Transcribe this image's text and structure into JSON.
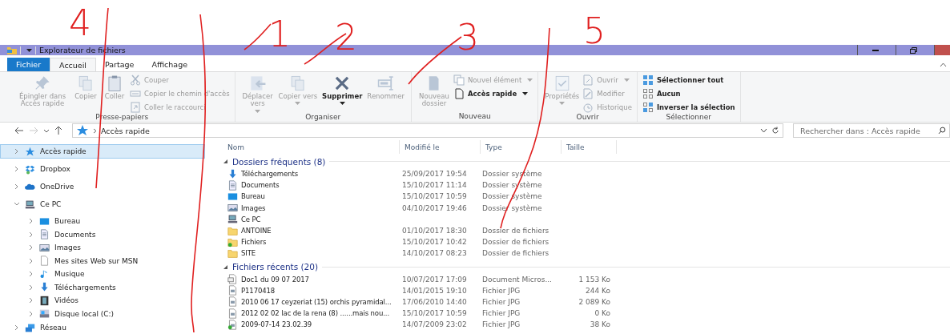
{
  "annotations": [
    "4",
    "1",
    "2",
    "3",
    "5"
  ],
  "window": {
    "title": "Explorateur de fichiers"
  },
  "tabs": [
    {
      "label": "Fichier",
      "kind": "file",
      "selected": false
    },
    {
      "label": "Accueil",
      "kind": "tab",
      "selected": true
    },
    {
      "label": "Partage",
      "kind": "tab",
      "selected": false
    },
    {
      "label": "Affichage",
      "kind": "tab",
      "selected": false
    }
  ],
  "ribbon": {
    "groups": [
      {
        "label": "Presse-papiers",
        "large": [
          {
            "label": "Épingler dans Accès rapide",
            "kind": "pin",
            "disabled": true,
            "dropdown": false
          },
          {
            "label": "Copier",
            "kind": "copy",
            "disabled": true,
            "dropdown": false
          },
          {
            "label": "Coller",
            "kind": "paste",
            "disabled": true,
            "dropdown": false
          }
        ],
        "small": [
          {
            "label": "Couper",
            "kind": "cut",
            "disabled": true,
            "dropdown": false
          },
          {
            "label": "Copier le chemin d'accès",
            "kind": "path",
            "disabled": true,
            "dropdown": false
          },
          {
            "label": "Coller le raccourci",
            "kind": "shortcut",
            "disabled": true,
            "dropdown": false
          }
        ]
      },
      {
        "label": "Organiser",
        "large": [
          {
            "label": "Déplacer vers",
            "kind": "move",
            "disabled": true,
            "dropdown": true
          },
          {
            "label": "Copier vers",
            "kind": "copyto",
            "disabled": true,
            "dropdown": true
          },
          {
            "label": "Supprimer",
            "kind": "delete",
            "disabled": false,
            "dropdown": true
          },
          {
            "label": "Renommer",
            "kind": "rename",
            "disabled": true,
            "dropdown": false
          }
        ]
      },
      {
        "label": "Nouveau",
        "large": [
          {
            "label": "Nouveau dossier",
            "kind": "newfolder",
            "disabled": true,
            "dropdown": false
          }
        ],
        "small": [
          {
            "label": "Nouvel élément",
            "kind": "newitem",
            "disabled": true,
            "dropdown": true
          },
          {
            "label": "Accès rapide",
            "kind": "easy",
            "disabled": false,
            "dropdown": true
          }
        ]
      },
      {
        "label": "Ouvrir",
        "large": [
          {
            "label": "Propriétés",
            "kind": "props",
            "disabled": true,
            "dropdown": true
          }
        ],
        "small": [
          {
            "label": "Ouvrir",
            "kind": "open",
            "disabled": true,
            "dropdown": true
          },
          {
            "label": "Modifier",
            "kind": "edit",
            "disabled": true,
            "dropdown": false
          },
          {
            "label": "Historique",
            "kind": "history",
            "disabled": true,
            "dropdown": false
          }
        ]
      },
      {
        "label": "Sélectionner",
        "small": [
          {
            "label": "Sélectionner tout",
            "kind": "selall",
            "disabled": false,
            "dropdown": false
          },
          {
            "label": "Aucun",
            "kind": "selnone",
            "disabled": false,
            "dropdown": false
          },
          {
            "label": "Inverser la sélection",
            "kind": "selinv",
            "disabled": false,
            "dropdown": false
          }
        ]
      }
    ]
  },
  "address": {
    "location": "Accès rapide",
    "forward_disabled": true
  },
  "search": {
    "placeholder": "Rechercher dans : Accès rapide"
  },
  "sidebar": {
    "items": [
      {
        "label": "Accès rapide",
        "kind": "star",
        "selected": true,
        "expanded": false
      },
      {
        "label": "Dropbox",
        "kind": "dropbox",
        "selected": false,
        "expanded": false
      },
      {
        "label": "OneDrive",
        "kind": "cloud",
        "selected": false,
        "expanded": false
      },
      {
        "label": "Ce PC",
        "kind": "pc",
        "selected": false,
        "expanded": true,
        "children": [
          {
            "label": "Bureau",
            "kind": "desktop",
            "selected": false,
            "expanded": false
          },
          {
            "label": "Documents",
            "kind": "docs",
            "selected": false,
            "expanded": false
          },
          {
            "label": "Images",
            "kind": "pictures",
            "selected": false,
            "expanded": false
          },
          {
            "label": "Mes sites Web sur MSN",
            "kind": "file",
            "selected": false,
            "expanded": false
          },
          {
            "label": "Musique",
            "kind": "music",
            "selected": false,
            "expanded": false
          },
          {
            "label": "Téléchargements",
            "kind": "download",
            "selected": false,
            "expanded": false
          },
          {
            "label": "Vidéos",
            "kind": "video",
            "selected": false,
            "expanded": false
          },
          {
            "label": "Disque local (C:)",
            "kind": "drive",
            "selected": false,
            "expanded": false
          }
        ]
      },
      {
        "label": "Réseau",
        "kind": "network",
        "selected": false,
        "expanded": false
      }
    ]
  },
  "table": {
    "columns": [
      "Nom",
      "Modifié le",
      "Type",
      "Taille"
    ],
    "groups": [
      {
        "title": "Dossiers fréquents (8)",
        "expanded": true,
        "rows": [
          {
            "name": "Téléchargements",
            "kind": "download",
            "modified": "25/09/2017 19:54",
            "type": "Dossier système"
          },
          {
            "name": "Documents",
            "kind": "docs",
            "modified": "15/10/2017 11:14",
            "type": "Dossier système"
          },
          {
            "name": "Bureau",
            "kind": "desktop",
            "modified": "15/10/2017 10:59",
            "type": "Dossier système"
          },
          {
            "name": "Images",
            "kind": "pictures",
            "modified": "04/10/2017 19:46",
            "type": "Dossier système"
          },
          {
            "name": "Ce PC",
            "kind": "pc"
          },
          {
            "name": "ANTOINE",
            "kind": "folder",
            "modified": "01/10/2017 18:30",
            "type": "Dossier de fichiers"
          },
          {
            "name": "Fichiers",
            "kind": "syncfolder",
            "modified": "15/10/2017 10:42",
            "type": "Dossier de fichiers"
          },
          {
            "name": "SITE",
            "kind": "folder",
            "modified": "14/10/2017 08:23",
            "type": "Dossier de fichiers"
          }
        ]
      },
      {
        "title": "Fichiers récents (20)",
        "expanded": true,
        "rows": [
          {
            "name": "Doc1 du 09 07 2017",
            "kind": "doc",
            "modified": "10/07/2017 17:09",
            "type": "Document Micros...",
            "size": "1 153 Ko"
          },
          {
            "name": "P1170418",
            "kind": "image",
            "modified": "14/01/2015 19:10",
            "type": "Fichier JPG",
            "size": "244 Ko"
          },
          {
            "name": "2010 06 17 ceyzeriat (15) orchis pyramidal...",
            "kind": "image",
            "modified": "17/06/2010 14:40",
            "type": "Fichier JPG",
            "size": "2 089 Ko"
          },
          {
            "name": "2012 02 02 lac de la rena (8) ......mais nou...",
            "kind": "image",
            "modified": "15/10/2017 10:59",
            "type": "Fichier JPG",
            "size": "0 Ko"
          },
          {
            "name": "2009-07-14 23.02.39",
            "kind": "syncimage",
            "modified": "14/07/2009 23:02",
            "type": "Fichier JPG",
            "size": "38 Ko"
          }
        ]
      }
    ]
  }
}
